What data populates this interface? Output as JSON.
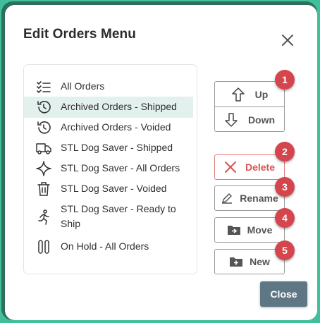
{
  "dialog": {
    "title": "Edit Orders Menu",
    "close_icon": "close-icon"
  },
  "list": {
    "items": [
      {
        "label": "All Orders",
        "icon": "checklist-icon",
        "selected": false
      },
      {
        "label": "Archived Orders - Shipped",
        "icon": "history-icon",
        "selected": true
      },
      {
        "label": "Archived Orders - Voided",
        "icon": "history-icon",
        "selected": false
      },
      {
        "label": "STL Dog Saver - Shipped",
        "icon": "truck-icon",
        "selected": false
      },
      {
        "label": "STL Dog Saver - All Orders",
        "icon": "sparkle-icon",
        "selected": false
      },
      {
        "label": "STL Dog Saver - Voided",
        "icon": "trash-icon",
        "selected": false
      },
      {
        "label": "STL Dog Saver - Ready to Ship",
        "icon": "running-person-icon",
        "selected": false
      },
      {
        "label": "On Hold - All Orders",
        "icon": "pause-icon",
        "selected": false
      }
    ]
  },
  "actions": {
    "up_label": "Up",
    "down_label": "Down",
    "delete_label": "Delete",
    "rename_label": "Rename",
    "move_label": "Move",
    "new_label": "New",
    "close_label": "Close"
  },
  "badges": [
    "1",
    "2",
    "3",
    "4",
    "5"
  ],
  "colors": {
    "accent": "#3fbf9a",
    "selected_row": "#e3f1ee",
    "delete": "#d9534f",
    "badge": "#d4454d",
    "close_button": "#5f7785"
  }
}
